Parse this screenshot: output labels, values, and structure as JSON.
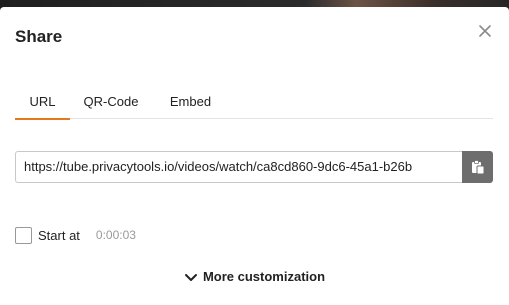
{
  "dialog": {
    "title": "Share",
    "close_icon": "close-icon"
  },
  "tabs": [
    {
      "label": "URL",
      "active": true
    },
    {
      "label": "QR-Code",
      "active": false
    },
    {
      "label": "Embed",
      "active": false
    }
  ],
  "url_field": {
    "value": "https://tube.privacytools.io/videos/watch/ca8cd860-9dc6-45a1-b26b",
    "copy_icon": "clipboard-icon"
  },
  "start_at": {
    "label": "Start at",
    "checked": false,
    "time": "0:00:03"
  },
  "more_customization": {
    "label": "More customization",
    "icon": "chevron-down-icon"
  },
  "colors": {
    "accent": "#e6781e",
    "copy_button": "#6d6d6d"
  }
}
